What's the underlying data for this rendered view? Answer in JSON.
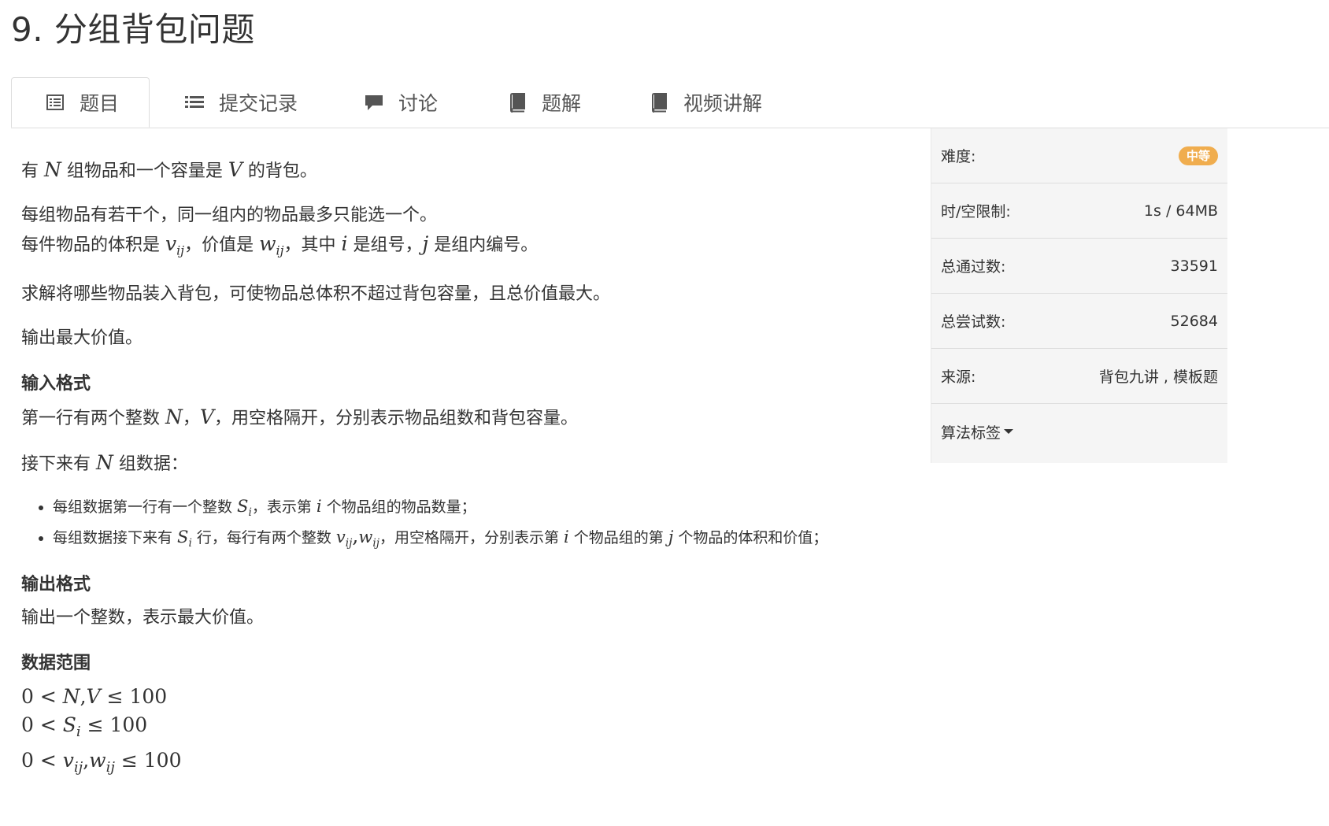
{
  "title": "9. 分组背包问题",
  "tabs": [
    {
      "label": "题目",
      "icon": "list-alt-icon"
    },
    {
      "label": "提交记录",
      "icon": "list-icon"
    },
    {
      "label": "讨论",
      "icon": "comment-icon"
    },
    {
      "label": "题解",
      "icon": "book-icon"
    },
    {
      "label": "视频讲解",
      "icon": "book-icon"
    }
  ],
  "sidebar": {
    "difficulty_label": "难度:",
    "difficulty_value": "中等",
    "limit_label": "时/空限制:",
    "limit_value": "1s / 64MB",
    "passed_label": "总通过数:",
    "passed_value": "33591",
    "tried_label": "总尝试数:",
    "tried_value": "52684",
    "source_label": "来源:",
    "source_value": "背包九讲 , 模板题",
    "tags_label": "算法标签"
  },
  "problem": {
    "intro_a": "有 ",
    "intro_N": "N",
    "intro_b": " 组物品和一个容量是 ",
    "intro_V": "V",
    "intro_c": " 的背包。",
    "line2": "每组物品有若干个，同一组内的物品最多只能选一个。",
    "line3_a": "每件物品的体积是 ",
    "line3_v": "v",
    "line3_sub1": "ij",
    "line3_b": "，价值是 ",
    "line3_w": "w",
    "line3_sub2": "ij",
    "line3_c": "，其中 ",
    "line3_i": "i",
    "line3_d": " 是组号，",
    "line3_j": "j",
    "line3_e": " 是组内编号。",
    "line4": "求解将哪些物品装入背包，可使物品总体积不超过背包容量，且总价值最大。",
    "line5": "输出最大价值。",
    "input_heading": "输入格式",
    "input_a": "第一行有两个整数 ",
    "input_N": "N",
    "input_b": "，",
    "input_V": "V",
    "input_c": "，用空格隔开，分别表示物品组数和背包容量。",
    "next_a": "接下来有 ",
    "next_N": "N",
    "next_b": " 组数据：",
    "bullet1_a": "每组数据第一行有一个整数 ",
    "bullet1_S": "S",
    "bullet1_sub": "i",
    "bullet1_b": "，表示第 ",
    "bullet1_i": "i",
    "bullet1_c": " 个物品组的物品数量；",
    "bullet2_a": "每组数据接下来有 ",
    "bullet2_S": "S",
    "bullet2_sub": "i",
    "bullet2_b": " 行，每行有两个整数 ",
    "bullet2_v": "v",
    "bullet2_sub1": "ij",
    "bullet2_comma": ",",
    "bullet2_w": "w",
    "bullet2_sub2": "ij",
    "bullet2_c": "，用空格隔开，分别表示第 ",
    "bullet2_i": "i",
    "bullet2_d": " 个物品组的第 ",
    "bullet2_j": "j",
    "bullet2_e": " 个物品的体积和价值；",
    "output_heading": "输出格式",
    "output_text": "输出一个整数，表示最大价值。",
    "range_heading": "数据范围",
    "range1_a": "0 < ",
    "range1_b": "N",
    "range1_c": ",",
    "range1_d": "V",
    "range1_e": " ≤ 100",
    "range2_a": "0 < ",
    "range2_b": "S",
    "range2_sub": "i",
    "range2_e": " ≤ 100",
    "range3_a": "0 < ",
    "range3_b": "v",
    "range3_sub1": "ij",
    "range3_c": ",",
    "range3_d": "w",
    "range3_sub2": "ij",
    "range3_e": " ≤ 100"
  },
  "colors": {
    "badge": "#f0ad4e",
    "sidebar_bg": "#f5f5f5",
    "text": "#333333"
  }
}
